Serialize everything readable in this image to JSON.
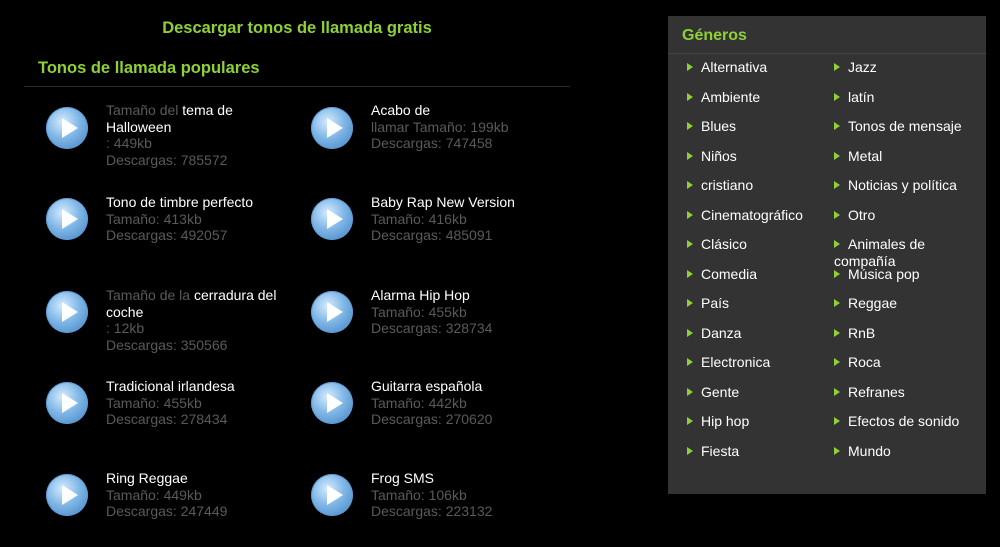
{
  "header": {
    "title": "Descargar tonos de llamada gratis",
    "section": "Tonos de llamada populares"
  },
  "tones": [
    {
      "name_pre": "Tamaño del ",
      "name": "tema de Halloween",
      "size": ": 449kb",
      "downloads": "Descargas: 785572"
    },
    {
      "name_pre": "",
      "name": "Acabo de",
      "size": "llamar Tamaño: 199kb",
      "downloads": "Descargas: 747458"
    },
    {
      "name_pre": "",
      "name": "Tono de timbre perfecto",
      "size": "Tamaño: 413kb",
      "downloads": "Descargas: 492057"
    },
    {
      "name_pre": "",
      "name": "Baby Rap New Version",
      "size": "Tamaño: 416kb",
      "downloads": "Descargas: 485091"
    },
    {
      "name_pre": "Tamaño de la ",
      "name": "cerradura del coche",
      "size": ": 12kb",
      "downloads": "Descargas: 350566"
    },
    {
      "name_pre": "",
      "name": "Alarma Hip Hop",
      "size": "Tamaño: 455kb",
      "downloads": "Descargas: 328734"
    },
    {
      "name_pre": "",
      "name": "Tradicional irlandesa",
      "size": "Tamaño: 455kb",
      "downloads": "Descargas: 278434"
    },
    {
      "name_pre": "",
      "name": "Guitarra española",
      "size": "Tamaño: 442kb",
      "downloads": "Descargas: 270620"
    },
    {
      "name_pre": "",
      "name": "Ring Reggae",
      "size": "Tamaño: 449kb",
      "downloads": "Descargas: 247449"
    },
    {
      "name_pre": "",
      "name": "Frog SMS",
      "size": "Tamaño: 106kb",
      "downloads": "Descargas: 223132"
    }
  ],
  "genres_panel": {
    "title": "Géneros",
    "left": [
      "Alternativa",
      "Ambiente",
      "Blues",
      "Niños",
      "cristiano",
      "Cinematográfico",
      "Clásico",
      "Comedia",
      "País",
      "Danza",
      "Electronica",
      "Gente",
      "Hip hop",
      "Fiesta"
    ],
    "right": [
      "Jazz",
      "latín",
      "Tonos de mensaje",
      "Metal",
      "Noticias y política",
      "Otro",
      "Animales de compañía",
      "Música pop",
      "Reggae",
      "RnB",
      "Roca",
      "Refranes",
      "Efectos de sonido",
      "Mundo"
    ]
  },
  "colors": {
    "accent": "#8ed137",
    "muted_text": "#5a5a5a",
    "panel_bg": "#333333",
    "play_button": "#7fb6e6"
  }
}
